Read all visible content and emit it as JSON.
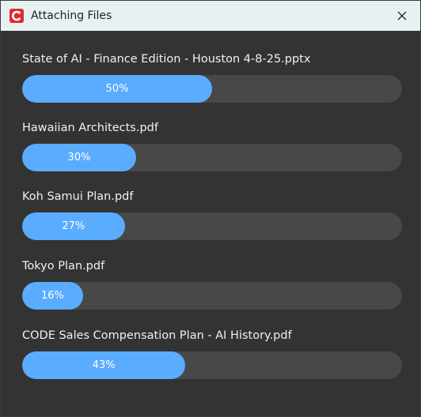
{
  "window": {
    "title": "Attaching Files"
  },
  "files": [
    {
      "name": "State of AI - Finance Edition - Houston 4-8-25.pptx",
      "progress_label": "50%",
      "progress": 0.5
    },
    {
      "name": "Hawaiian Architects.pdf",
      "progress_label": "30%",
      "progress": 0.3
    },
    {
      "name": "Koh Samui Plan.pdf",
      "progress_label": "27%",
      "progress": 0.27
    },
    {
      "name": "Tokyo Plan.pdf",
      "progress_label": "16%",
      "progress": 0.16
    },
    {
      "name": "CODE Sales Compensation Plan - AI History.pdf",
      "progress_label": "43%",
      "progress": 0.43
    }
  ],
  "colors": {
    "progress_fill": "#5aacff",
    "progress_track": "#484848",
    "background": "#333333",
    "titlebar": "#e8f1f2",
    "app_icon": "#e0282e"
  },
  "icons": {
    "app": "app-logo-icon",
    "close": "close-icon"
  }
}
